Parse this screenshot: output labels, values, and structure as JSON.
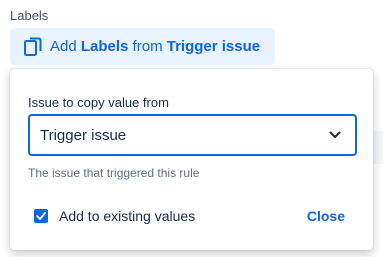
{
  "field": {
    "label": "Labels"
  },
  "summary": {
    "prefix": "Add ",
    "field_name": "Labels",
    "middle": " from ",
    "source": "Trigger issue",
    "icon": "copy-icon"
  },
  "popup": {
    "select_label": "Issue to copy value from",
    "select_value": "Trigger issue",
    "helper_text": "The issue that triggered this rule",
    "checkbox_label": "Add to existing values",
    "checkbox_checked": true,
    "close_label": "Close"
  },
  "colors": {
    "accent": "#0c66e4",
    "chip_bg": "#e9f2ff",
    "text": "#172b4d",
    "subtle_text": "#626f86"
  }
}
